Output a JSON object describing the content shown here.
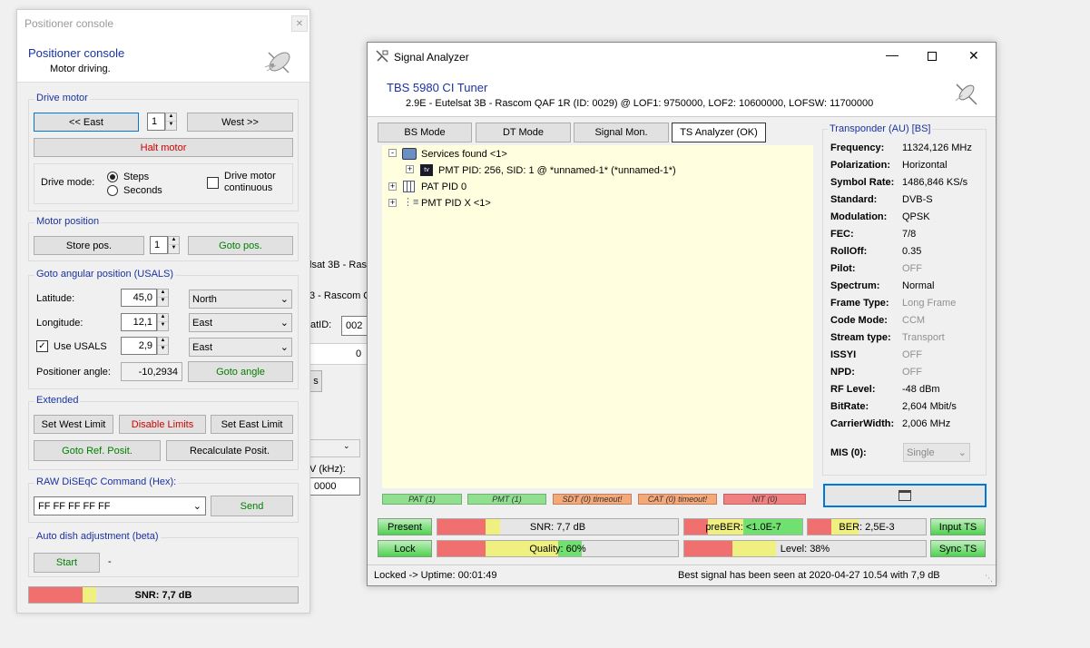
{
  "background_window": {
    "fragments": [
      "lsat 3B - Rasc",
      "3 - Rascom Q",
      "atID:",
      "002",
      "0",
      "s",
      "V (kHz):",
      "0000"
    ]
  },
  "positioner": {
    "window_title": "Positioner console",
    "header_title": "Positioner console",
    "header_subtitle": "Motor driving.",
    "drive_motor": {
      "title": "Drive motor",
      "east_label": "<< East",
      "step_value": "1",
      "west_label": "West >>",
      "halt_label": "Halt motor",
      "drive_mode_label": "Drive mode:",
      "steps_label": "Steps",
      "seconds_label": "Seconds",
      "continuous_label_1": "Drive motor",
      "continuous_label_2": "continuous"
    },
    "motor_position": {
      "title": "Motor position",
      "store_label": "Store pos.",
      "position_value": "1",
      "goto_label": "Goto pos."
    },
    "usals": {
      "title": "Goto angular position (USALS)",
      "latitude_label": "Latitude:",
      "latitude_value": "45,0",
      "latitude_dir": "North",
      "longitude_label": "Longitude:",
      "longitude_value": "12,1",
      "longitude_dir": "East",
      "use_usals_label": "Use USALS",
      "usals_value": "2,9",
      "usals_dir": "East",
      "angle_label": "Positioner angle:",
      "angle_value": "-10,2934",
      "goto_angle_label": "Goto angle"
    },
    "extended": {
      "title": "Extended",
      "set_west_label": "Set West Limit",
      "disable_limits_label": "Disable Limits",
      "set_east_label": "Set East Limit",
      "goto_ref_label": "Goto Ref. Posit.",
      "recalc_label": "Recalculate Posit."
    },
    "raw": {
      "title": "RAW DiSEqC Command (Hex):",
      "command_value": "FF FF FF FF FF",
      "send_label": "Send"
    },
    "auto_dish": {
      "title": "Auto dish adjustment (beta)",
      "start_label": "Start",
      "status": "-"
    },
    "snr_label": "SNR: 7,7 dB",
    "snr_fraction": 0.25
  },
  "analyzer": {
    "window_title": "Signal Analyzer",
    "tuner_name": "TBS 5980 CI Tuner",
    "tuner_info": "2.9E - Eutelsat 3B - Rascom QAF 1R (ID: 0029) @ LOF1: 9750000, LOF2: 10600000, LOFSW: 11700000",
    "tabs": [
      "BS Mode",
      "DT Mode",
      "Signal Mon.",
      "TS Analyzer (OK)"
    ],
    "tree": {
      "services": "Services found <1>",
      "pmt_entry": "PMT PID: 256, SID: 1 @ *unnamed-1* (*unnamed-1*)",
      "pat": "PAT PID 0",
      "pmt_x": "PMT PID X <1>"
    },
    "status_bars": [
      "PAT (1)",
      "PMT (1)",
      "SDT (0) timeout!",
      "CAT (0) timeout!",
      "NIT (0)"
    ],
    "transponder": {
      "title": "Transponder (AU) [BS]",
      "rows": [
        {
          "label": "Frequency:",
          "value": "11324,126 MHz"
        },
        {
          "label": "Polarization:",
          "value": "Horizontal"
        },
        {
          "label": "Symbol Rate:",
          "value": "1486,846 KS/s"
        },
        {
          "label": "Standard:",
          "value": "DVB-S"
        },
        {
          "label": "Modulation:",
          "value": "QPSK"
        },
        {
          "label": "FEC:",
          "value": "7/8"
        },
        {
          "label": "RollOff:",
          "value": "0.35"
        },
        {
          "label": "Pilot:",
          "value": "OFF"
        },
        {
          "label": "Spectrum:",
          "value": "Normal"
        },
        {
          "label": "Frame Type:",
          "value": "Long Frame"
        },
        {
          "label": "Code Mode:",
          "value": "CCM"
        },
        {
          "label": "Stream type:",
          "value": "Transport"
        },
        {
          "label": "ISSYI",
          "value": "OFF"
        },
        {
          "label": "NPD:",
          "value": "OFF"
        },
        {
          "label": "RF Level:",
          "value": "-48 dBm"
        },
        {
          "label": "BitRate:",
          "value": "2,604 Mbit/s"
        },
        {
          "label": "CarrierWidth:",
          "value": "2,006 MHz"
        }
      ],
      "mis_label": "MIS (0):",
      "mis_value": "Single"
    },
    "indicators": {
      "present": "Present",
      "lock": "Lock",
      "input_ts": "Input TS",
      "sync_ts": "Sync TS"
    },
    "meters": {
      "snr": {
        "label": "SNR: 7,7 dB",
        "fraction": 0.26
      },
      "preber": {
        "label": "preBER: <1.0E-7",
        "fraction": 1.0
      },
      "ber": {
        "label": "BER: 2,5E-3",
        "fraction": 0.43
      },
      "quality": {
        "label": "Quality: 60%",
        "fraction": 0.6
      },
      "level": {
        "label": "Level: 38%",
        "fraction": 0.38
      }
    },
    "status_left": "Locked -> Uptime: 00:01:49",
    "status_right": "Best signal has been seen at 2020-04-27 10.54 with 7,9 dB"
  },
  "colors": {
    "accent": "#1a32a0",
    "red_text": "#d00000",
    "green_text": "#008000",
    "meter_red": "#f07070",
    "meter_yellow": "#f0f080",
    "meter_green": "#70e070",
    "tree_bg": "#ffffe0"
  }
}
